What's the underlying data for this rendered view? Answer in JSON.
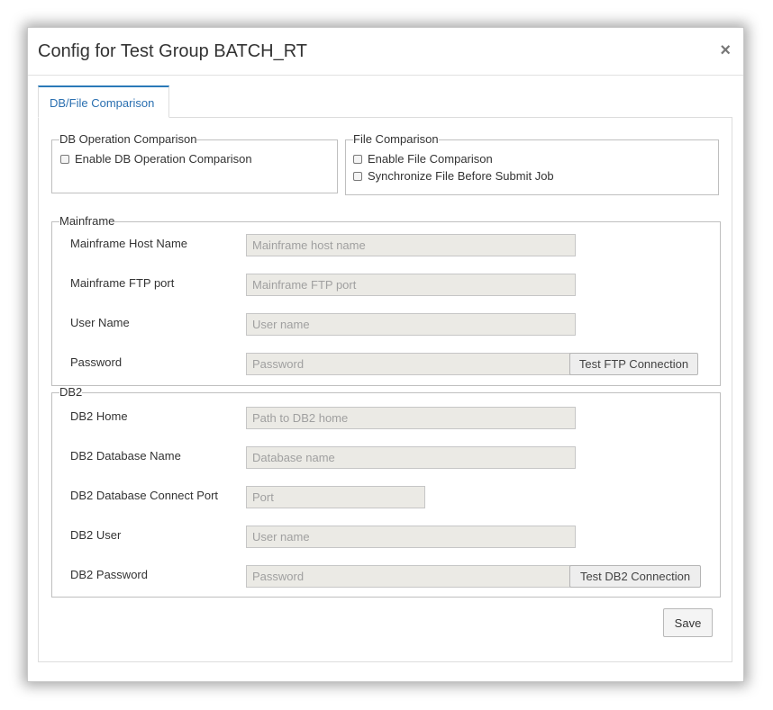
{
  "dialog": {
    "title": "Config for Test Group BATCH_RT",
    "close_label": "×"
  },
  "tabs": [
    {
      "label": "DB/File Comparison",
      "active": true
    }
  ],
  "db_operation_comparison": {
    "legend": "DB Operation Comparison",
    "enable_label": "Enable DB Operation Comparison",
    "enable_checked": false
  },
  "file_comparison": {
    "legend": "File Comparison",
    "enable_label": "Enable File Comparison",
    "enable_checked": false,
    "sync_label": "Synchronize File Before Submit Job",
    "sync_checked": false
  },
  "mainframe": {
    "legend": "Mainframe",
    "host": {
      "label": "Mainframe Host Name",
      "value": "",
      "placeholder": "Mainframe host name"
    },
    "ftp_port": {
      "label": "Mainframe FTP port",
      "value": "",
      "placeholder": "Mainframe FTP port"
    },
    "user": {
      "label": "User Name",
      "value": "",
      "placeholder": "User name"
    },
    "password": {
      "label": "Password",
      "value": "",
      "placeholder": "Password"
    },
    "test_button": "Test FTP Connection"
  },
  "db2": {
    "legend": "DB2",
    "home": {
      "label": "DB2 Home",
      "value": "",
      "placeholder": "Path to DB2 home"
    },
    "database_name": {
      "label": "DB2 Database Name",
      "value": "",
      "placeholder": "Database name"
    },
    "connect_port": {
      "label": "DB2 Database Connect Port",
      "value": "",
      "placeholder": "Port"
    },
    "user": {
      "label": "DB2 User",
      "value": "",
      "placeholder": "User name"
    },
    "password": {
      "label": "DB2 Password",
      "value": "",
      "placeholder": "Password"
    },
    "test_button": "Test DB2 Connection"
  },
  "footer": {
    "save_label": "Save"
  },
  "colors": {
    "accent": "#2a7ab8",
    "input_background": "#ebeae5"
  }
}
